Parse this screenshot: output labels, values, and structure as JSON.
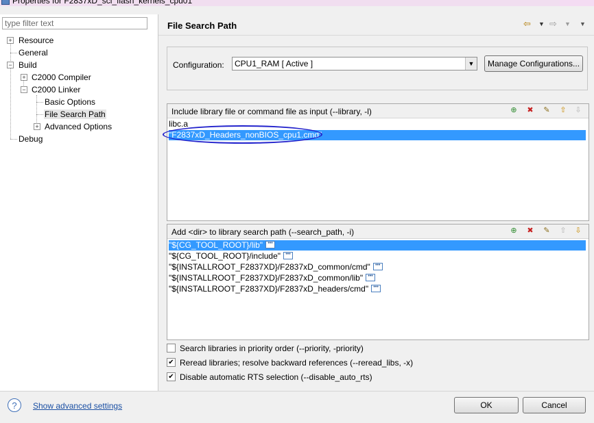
{
  "window": {
    "title": "Properties for F2837xD_sci_flash_kernels_cpu01"
  },
  "filter": {
    "placeholder": "type filter text"
  },
  "tree": {
    "resource": "Resource",
    "general": "General",
    "build": "Build",
    "c2000_compiler": "C2000 Compiler",
    "c2000_linker": "C2000 Linker",
    "basic_options": "Basic Options",
    "file_search_path": "File Search Path",
    "advanced_options": "Advanced Options",
    "debug": "Debug"
  },
  "page": {
    "title": "File Search Path"
  },
  "config": {
    "label": "Configuration:",
    "value": "CPU1_RAM  [ Active ]",
    "manage_label": "Manage Configurations..."
  },
  "library_list": {
    "header": "Include library file or command file as input (--library, -l)",
    "items": [
      "libc.a",
      "\"F2837xD_Headers_nonBIOS_cpu1.cmd\""
    ]
  },
  "path_list": {
    "header": "Add <dir> to library search path (--search_path, -i)",
    "items": [
      "\"${CG_TOOL_ROOT}/lib\"",
      "\"${CG_TOOL_ROOT}/include\"",
      "\"${INSTALLROOT_F2837XD}/F2837xD_common/cmd\"",
      "\"${INSTALLROOT_F2837XD}/F2837xD_common/lib\"",
      "\"${INSTALLROOT_F2837XD}/F2837xD_headers/cmd\""
    ]
  },
  "options": {
    "priority": {
      "label": "Search libraries in priority order (--priority, -priority)",
      "checked": false
    },
    "reread": {
      "label": "Reread libraries; resolve backward references (--reread_libs, -x)",
      "checked": true
    },
    "disable_rts": {
      "label": "Disable automatic RTS selection (--disable_auto_rts)",
      "checked": true
    }
  },
  "footer": {
    "help_symbol": "?",
    "advanced_link": "Show advanced settings",
    "ok": "OK",
    "cancel": "Cancel"
  },
  "colors": {
    "selection": "#3399ff",
    "annotation_circle": "#2222cc",
    "link": "#1a4fa3"
  }
}
